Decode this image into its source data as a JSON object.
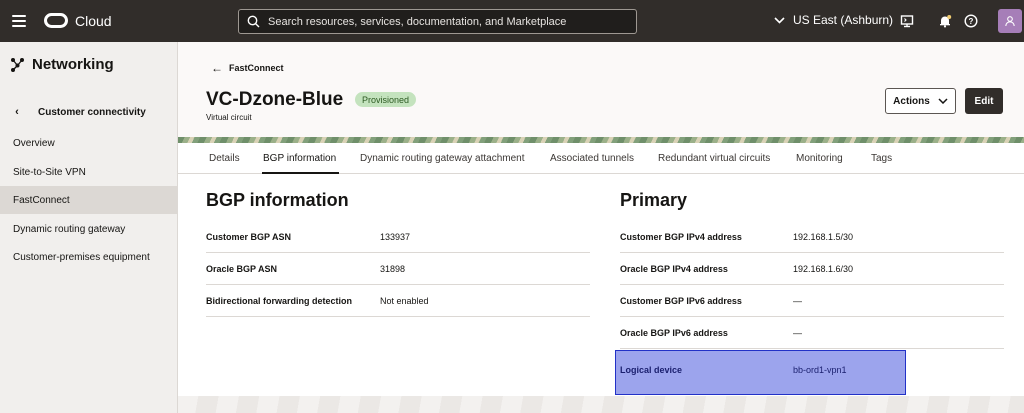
{
  "topbar": {
    "brand": "Cloud",
    "search_placeholder": "Search resources, services, documentation, and Marketplace",
    "region": "US East (Ashburn)"
  },
  "sidebar": {
    "title": "Networking",
    "back_label": "Customer connectivity",
    "items": [
      {
        "label": "Overview"
      },
      {
        "label": "Site-to-Site VPN"
      },
      {
        "label": "FastConnect"
      },
      {
        "label": "Dynamic routing gateway"
      },
      {
        "label": "Customer-premises equipment"
      }
    ]
  },
  "header": {
    "back_label": "FastConnect",
    "title": "VC-Dzone-Blue",
    "badge": "Provisioned",
    "subtitle": "Virtual circuit",
    "actions_label": "Actions",
    "edit_label": "Edit"
  },
  "tabs": [
    {
      "label": "Details"
    },
    {
      "label": "BGP information"
    },
    {
      "label": "Dynamic routing gateway attachment"
    },
    {
      "label": "Associated tunnels"
    },
    {
      "label": "Redundant virtual circuits"
    },
    {
      "label": "Monitoring"
    },
    {
      "label": "Tags"
    }
  ],
  "bgp": {
    "title": "BGP information",
    "rows": [
      {
        "label": "Customer BGP ASN",
        "value": "133937"
      },
      {
        "label": "Oracle BGP ASN",
        "value": "31898"
      },
      {
        "label": "Bidirectional forwarding detection",
        "value": "Not enabled"
      }
    ]
  },
  "primary": {
    "title": "Primary",
    "rows": [
      {
        "label": "Customer BGP IPv4 address",
        "value": "192.168.1.5/30"
      },
      {
        "label": "Oracle BGP IPv4 address",
        "value": "192.168.1.6/30"
      },
      {
        "label": "Customer BGP IPv6 address",
        "value": "—"
      },
      {
        "label": "Oracle BGP IPv6 address",
        "value": "—"
      },
      {
        "label": "Logical device",
        "value": "bb-ord1-vpn1"
      }
    ]
  },
  "colors": {
    "topbar": "#312d2a",
    "badge_bg": "#c4e3be",
    "highlight": "#606ce2",
    "highlight_border": "#2231c7"
  }
}
